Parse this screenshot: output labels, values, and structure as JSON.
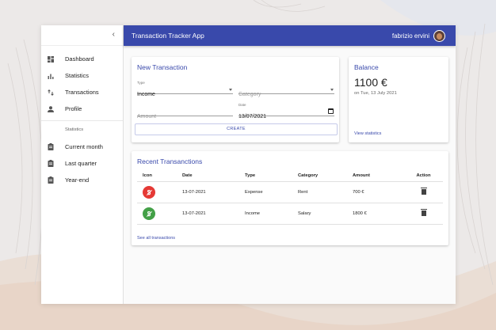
{
  "app": {
    "title": "Transaction Tracker App",
    "user_name": "fabrizio ervini"
  },
  "colors": {
    "primary": "#3949ab",
    "expense": "#e53935",
    "income": "#43a047"
  },
  "sidebar": {
    "collapse_icon": "chevron-left-icon",
    "items": [
      {
        "label": "Dashboard",
        "icon": "dashboard-icon"
      },
      {
        "label": "Statistics",
        "icon": "bar-chart-icon"
      },
      {
        "label": "Transactions",
        "icon": "swap-vert-icon"
      },
      {
        "label": "Profile",
        "icon": "person-icon"
      }
    ],
    "subheader": "Statistics",
    "stats_items": [
      {
        "label": "Current month",
        "icon": "assignment-icon"
      },
      {
        "label": "Last quarter",
        "icon": "assignment-icon"
      },
      {
        "label": "Year-end",
        "icon": "assignment-icon"
      }
    ]
  },
  "new_transaction": {
    "title": "New Transaction",
    "type_label": "Type",
    "type_value": "Income",
    "category_placeholder": "Category",
    "amount_placeholder": "Amount",
    "date_label": "Date",
    "date_value": "13/07/2021",
    "create_label": "CREATE"
  },
  "balance": {
    "title": "Balance",
    "amount": "1100 €",
    "date_text": "on Tue, 13 July 2021",
    "view_stats_label": "View statistics"
  },
  "recent": {
    "title": "Recent Transanctions",
    "columns": [
      "Icon",
      "Date",
      "Type",
      "Category",
      "Amount",
      "Action"
    ],
    "rows": [
      {
        "date": "13-07-2021",
        "type": "Expense",
        "category": "Rent",
        "amount": "700 €",
        "icon": "money-off-icon",
        "action_icon": "delete-icon"
      },
      {
        "date": "13-07-2021",
        "type": "Income",
        "category": "Salary",
        "amount": "1800 €",
        "icon": "money-off-icon",
        "action_icon": "delete-icon"
      }
    ],
    "see_all_label": "See all transactions"
  }
}
